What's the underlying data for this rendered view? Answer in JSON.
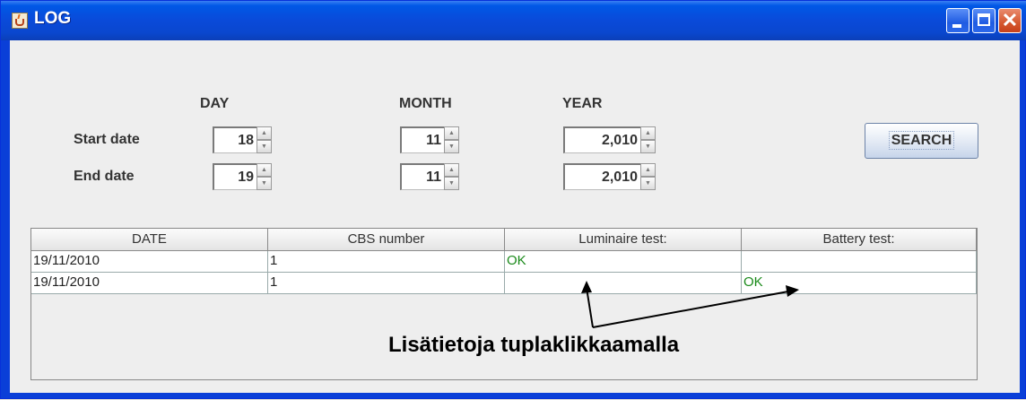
{
  "window": {
    "title": "LOG",
    "icon": "java-cup-icon"
  },
  "form": {
    "headers": {
      "day": "DAY",
      "month": "MONTH",
      "year": "YEAR"
    },
    "start": {
      "label": "Start date",
      "day": "18",
      "month": "11",
      "year": "2,010"
    },
    "end": {
      "label": "End date",
      "day": "19",
      "month": "11",
      "year": "2,010"
    },
    "search_label": "SEARCH"
  },
  "table": {
    "columns": [
      "DATE",
      "CBS number",
      "Luminaire test:",
      "Battery test:"
    ],
    "rows": [
      [
        "19/11/2010",
        "1",
        "OK",
        ""
      ],
      [
        "19/11/2010",
        "1",
        "",
        "OK"
      ]
    ]
  },
  "annotation": {
    "text": "Lisätietoja tuplaklikkaamalla"
  },
  "colors": {
    "ok_text": "#1a8a1a",
    "titlebar": "#0a4ad9"
  }
}
